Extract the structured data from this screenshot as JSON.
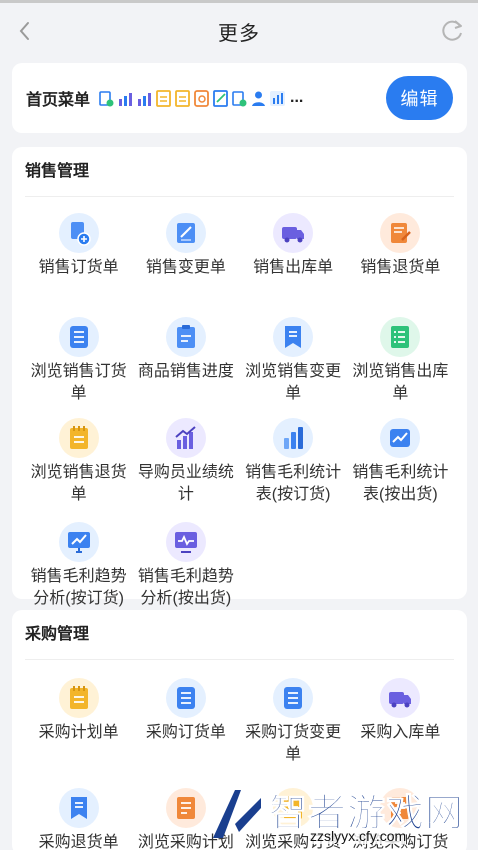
{
  "header": {
    "title": "更多"
  },
  "home_menu": {
    "title": "首页菜单",
    "ellipsis": "...",
    "edit_label": "编辑",
    "mini_icons": [
      "sales-order-icon",
      "chart-icon",
      "chart-icon",
      "doc-icon",
      "doc-icon",
      "return-icon",
      "report-icon",
      "sales-order-icon",
      "user-icon",
      "bar-chart-icon"
    ]
  },
  "sales": {
    "title": "销售管理",
    "items": [
      {
        "label": "销售订货单",
        "icon": "add-order-icon"
      },
      {
        "label": "销售变更单",
        "icon": "edit-doc-icon"
      },
      {
        "label": "销售出库单",
        "icon": "truck-icon"
      },
      {
        "label": "销售退货单",
        "icon": "return-doc-icon"
      },
      {
        "label": "浏览销售订货单",
        "icon": "list-icon"
      },
      {
        "label": "商品销售进度",
        "icon": "clipboard-icon"
      },
      {
        "label": "浏览销售变更单",
        "icon": "bookmark-doc-icon"
      },
      {
        "label": "浏览销售出库单",
        "icon": "list-check-icon"
      },
      {
        "label": "浏览销售退货单",
        "icon": "notepad-icon"
      },
      {
        "label": "导购员业绩统计",
        "icon": "bar-growth-icon"
      },
      {
        "label": "销售毛利统计表(按订货)",
        "icon": "bar-stats-icon"
      },
      {
        "label": "销售毛利统计表(按出货)",
        "icon": "trend-card-icon"
      },
      {
        "label": "销售毛利趋势分析(按订货)",
        "icon": "monitor-trend-icon"
      },
      {
        "label": "销售毛利趋势分析(按出货)",
        "icon": "monitor-wave-icon"
      }
    ]
  },
  "purchase": {
    "title": "采购管理",
    "items": [
      {
        "label": "采购计划单",
        "icon": "notepad-icon"
      },
      {
        "label": "采购订货单",
        "icon": "list-icon"
      },
      {
        "label": "采购订货变更单",
        "icon": "list-icon"
      },
      {
        "label": "采购入库单",
        "icon": "truck-icon"
      },
      {
        "label": "采购退货单",
        "icon": "bookmark-doc-icon"
      },
      {
        "label": "浏览采购计划单",
        "icon": "doc-icon"
      },
      {
        "label": "浏览采购订货单",
        "icon": "notepad-icon"
      },
      {
        "label": "浏览采购订货变更单",
        "icon": "doc-icon"
      }
    ]
  },
  "watermark": {
    "text": "智者游戏网",
    "url": "zzslyyx.cfy.com"
  },
  "colors": {
    "accent": "#2a7cf0",
    "purple": "#6a5fe0",
    "orange": "#f0883a",
    "yellow": "#f3b52a",
    "green": "#2ec27a"
  }
}
